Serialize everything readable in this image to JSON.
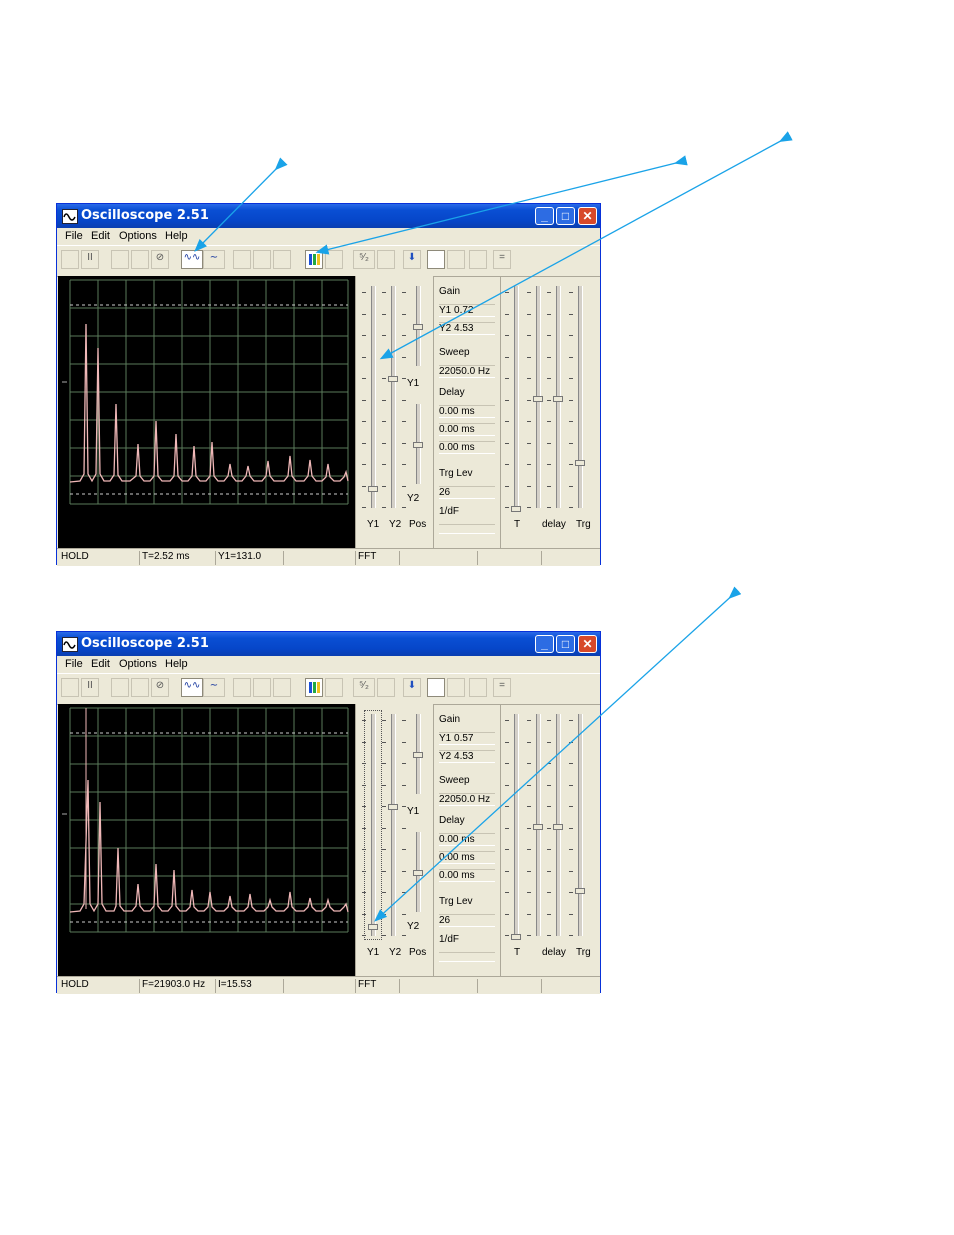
{
  "windows": [
    {
      "title": "Oscilloscope 2.51",
      "menu": [
        "File",
        "Edit",
        "Options",
        "Help"
      ],
      "slider_labels": {
        "y1": "Y1",
        "y2": "Y2",
        "pos": "Pos",
        "y1_side": "Y1",
        "y2_side": "Y2"
      },
      "readout": {
        "gain_label": "Gain",
        "y1_gain": "Y1  0.72",
        "y2_gain": "Y2  4.53",
        "sweep_label": "Sweep",
        "sweep_value": "22050.0 Hz",
        "delay_label": "Delay",
        "delay1": "0.00 ms",
        "delay2": "0.00 ms",
        "delay3": "0.00 ms",
        "trg_label": "Trg Lev",
        "trg_value": "26",
        "df_label": "1/dF"
      },
      "right_labels": {
        "t": "T",
        "delay": "delay",
        "trg": "Trg"
      },
      "status": [
        "HOLD",
        "T=2.52 ms",
        "Y1=131.0",
        "",
        "FFT",
        "",
        "",
        ""
      ]
    },
    {
      "title": "Oscilloscope 2.51",
      "menu": [
        "File",
        "Edit",
        "Options",
        "Help"
      ],
      "slider_labels": {
        "y1": "Y1",
        "y2": "Y2",
        "pos": "Pos",
        "y1_side": "Y1",
        "y2_side": "Y2"
      },
      "readout": {
        "gain_label": "Gain",
        "y1_gain": "Y1  0.57",
        "y2_gain": "Y2  4.53",
        "sweep_label": "Sweep",
        "sweep_value": "22050.0 Hz",
        "delay_label": "Delay",
        "delay1": "0.00 ms",
        "delay2": "0.00 ms",
        "delay3": "0.00 ms",
        "trg_label": "Trg Lev",
        "trg_value": "26",
        "df_label": "1/dF"
      },
      "right_labels": {
        "t": "T",
        "delay": "delay",
        "trg": "Trg"
      },
      "status": [
        "HOLD",
        "F=21903.0 Hz",
        "I=15.53",
        "",
        "FFT",
        "",
        "",
        ""
      ]
    }
  ],
  "colors": {
    "trace": "#f0b8b8",
    "grid": "#7a9a7a",
    "annotation_arrow": "#1aa3e8",
    "titlebar": "#0a4fd4"
  }
}
